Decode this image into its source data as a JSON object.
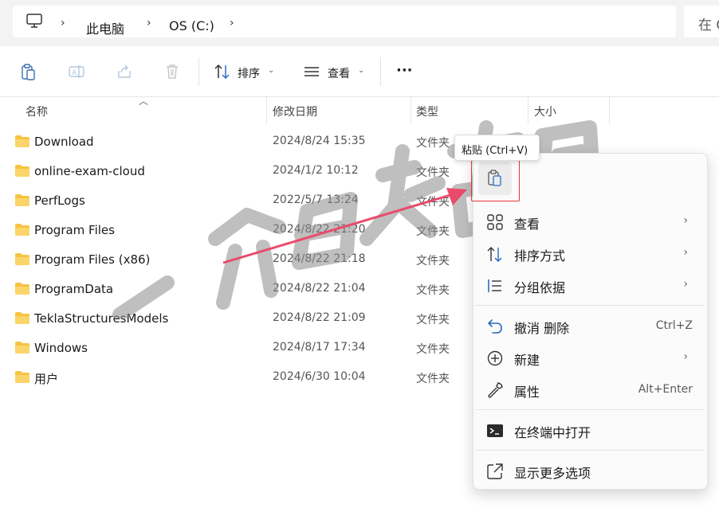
{
  "address": {
    "crumbs": [
      "此电脑",
      "OS (C:)"
    ],
    "search_partial": "在 C"
  },
  "toolbar": {
    "sort_label": "排序",
    "view_label": "查看",
    "more_label": "···"
  },
  "columns": {
    "name": "名称",
    "date": "修改日期",
    "type": "类型",
    "size": "大小"
  },
  "files": [
    {
      "name": "Download",
      "date": "2024/8/24 15:35",
      "type": "文件夹"
    },
    {
      "name": "online-exam-cloud",
      "date": "2024/1/2 10:12",
      "type": "文件夹"
    },
    {
      "name": "PerfLogs",
      "date": "2022/5/7 13:24",
      "type": "文件夹"
    },
    {
      "name": "Program Files",
      "date": "2024/8/22 21:20",
      "type": "文件夹"
    },
    {
      "name": "Program Files (x86)",
      "date": "2024/8/22 21:18",
      "type": "文件夹"
    },
    {
      "name": "ProgramData",
      "date": "2024/8/22 21:04",
      "type": "文件夹"
    },
    {
      "name": "TeklaStructuresModels",
      "date": "2024/8/22 21:09",
      "type": "文件夹"
    },
    {
      "name": "Windows",
      "date": "2024/8/17 17:34",
      "type": "文件夹"
    },
    {
      "name": "用户",
      "date": "2024/6/30 10:04",
      "type": "文件夹"
    }
  ],
  "tooltip": "粘贴 (Ctrl+V)",
  "context_menu": {
    "view": "查看",
    "sort_by": "排序方式",
    "group_by": "分组依据",
    "undo_delete": "撤消 删除",
    "undo_shortcut": "Ctrl+Z",
    "new": "新建",
    "properties": "属性",
    "properties_shortcut": "Alt+Enter",
    "open_terminal": "在终端中打开",
    "more_options": "显示更多选项"
  },
  "watermark_text": "一介白衣书生",
  "colors": {
    "folder": "#f6c342",
    "highlight_box": "#e23a3a",
    "arrow": "#ea4b6b"
  }
}
